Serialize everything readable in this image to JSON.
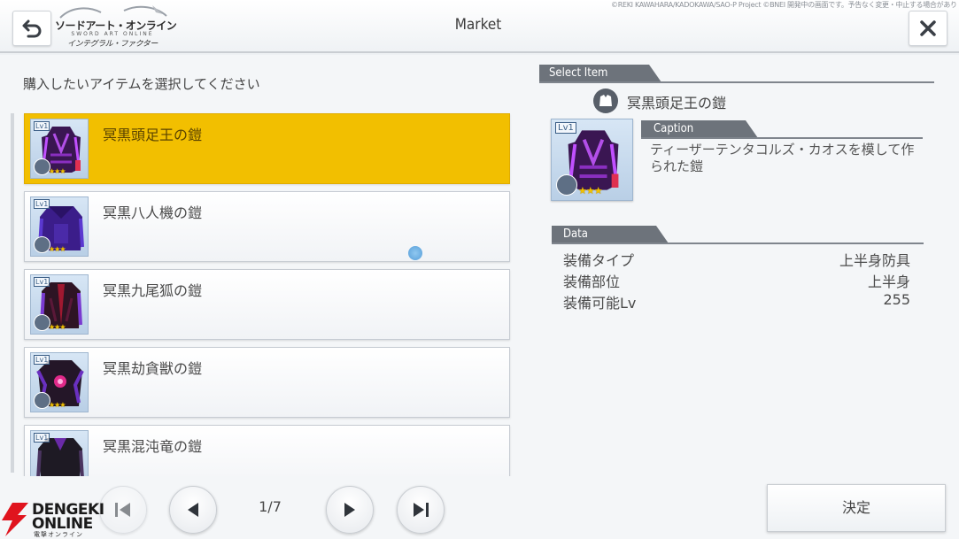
{
  "header": {
    "title": "Market",
    "logo_title": "ソードアート・オンライン",
    "logo_sub": "SWORD ART ONLINE",
    "logo_tagline": "インテグラル・ファクター",
    "copyright": "©REKI KAWAHARA/KADOKAWA/SAO-P Project ©BNEI 開発中の画面です。予告なく変更・中止する場合があります。"
  },
  "instruction": "購入したいアイテムを選択してください",
  "items": [
    {
      "name": "冥黒頭足王の鎧",
      "lv": "Lv1",
      "stars": "★★★",
      "selected": true
    },
    {
      "name": "冥黒八人機の鎧",
      "lv": "Lv1",
      "stars": "★★★",
      "selected": false
    },
    {
      "name": "冥黒九尾狐の鎧",
      "lv": "Lv1",
      "stars": "★★★",
      "selected": false
    },
    {
      "name": "冥黒劫貪獣の鎧",
      "lv": "Lv1",
      "stars": "★★★",
      "selected": false
    },
    {
      "name": "冥黒混沌竜の鎧",
      "lv": "Lv1",
      "stars": "★★★",
      "selected": false
    }
  ],
  "detail": {
    "select_label": "Select Item",
    "item_name": "冥黒頭足王の鎧",
    "lv": "Lv1",
    "stars": "★★★",
    "caption_label": "Caption",
    "caption": "ティーザーテンタコルズ・カオスを模して作られた鎧",
    "data_label": "Data",
    "rows": [
      {
        "key": "装備タイプ",
        "value": "上半身防具"
      },
      {
        "key": "装備部位",
        "value": "上半身"
      },
      {
        "key": "装備可能Lv",
        "value": "255"
      }
    ]
  },
  "pager": {
    "indicator": "1/7"
  },
  "decide_label": "決定",
  "watermark": {
    "line1": "DENGEKI",
    "line2": "ONLINE",
    "line3": "電撃オンライン"
  },
  "colors": {
    "selected": "#f2bf00",
    "tab": "#6d737b",
    "cursor": "#3c8fd4"
  },
  "icons": [
    "back-arrow-icon",
    "close-icon",
    "armor-type-icon",
    "first-page-icon",
    "prev-page-icon",
    "next-page-icon",
    "last-page-icon"
  ]
}
